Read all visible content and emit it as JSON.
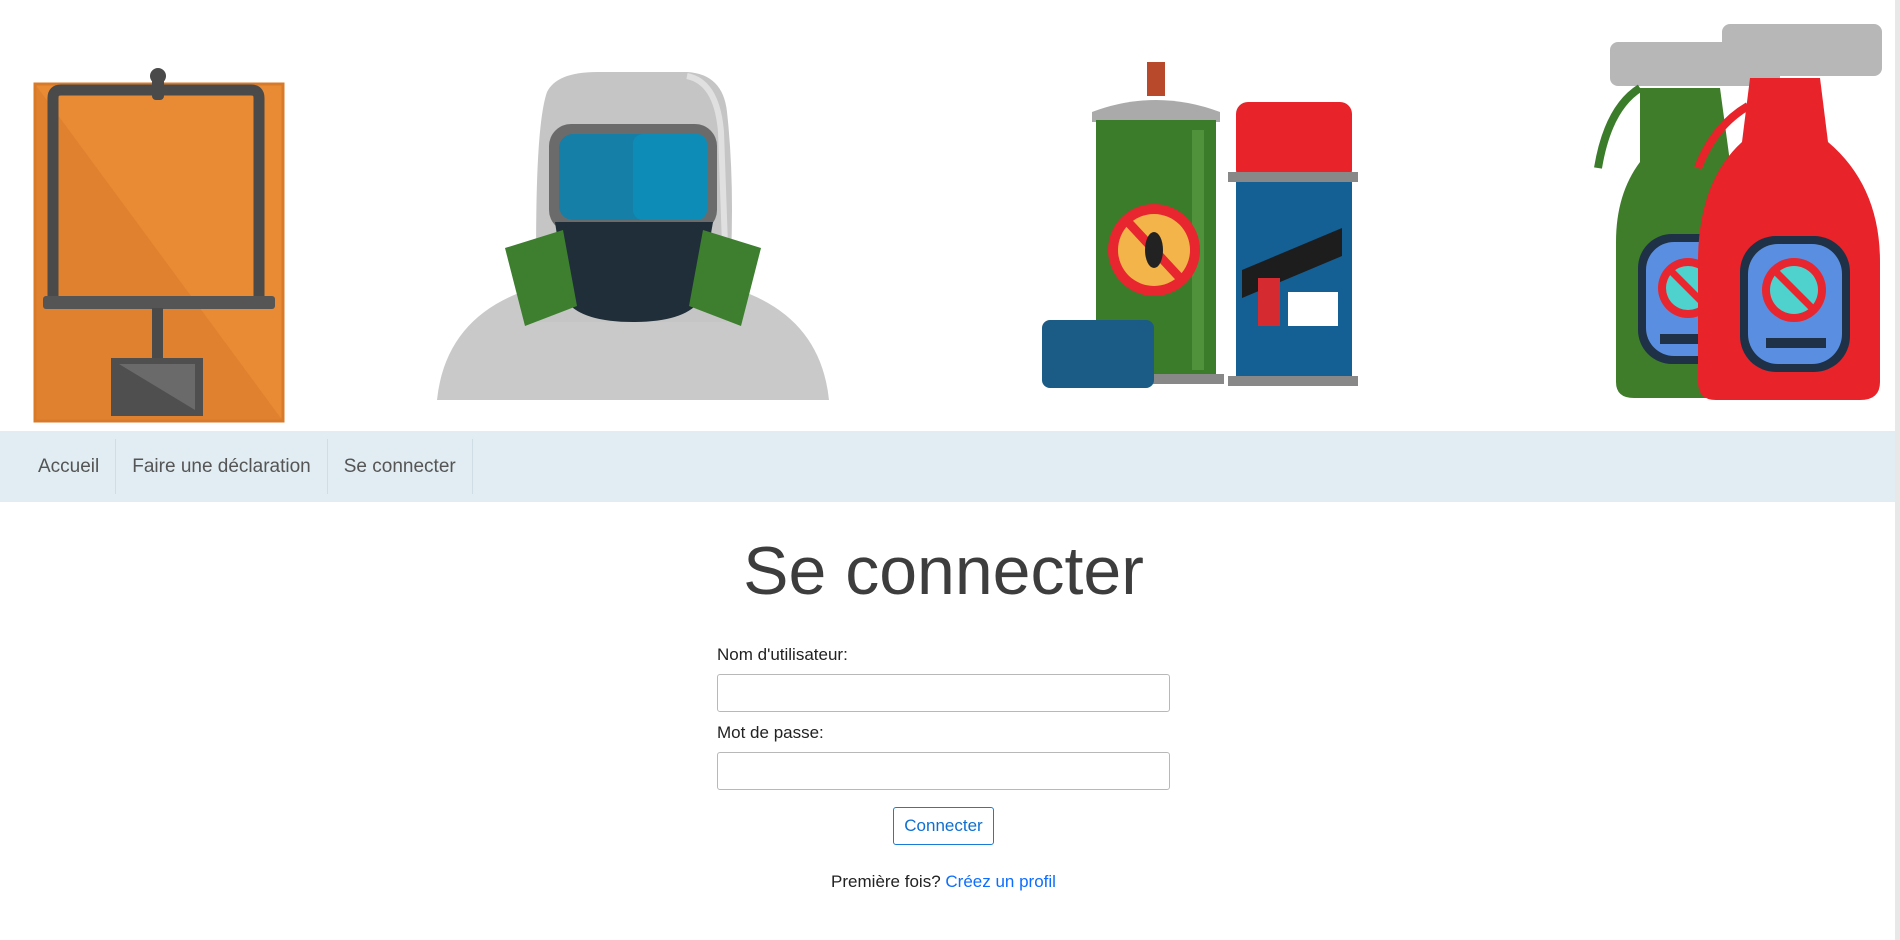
{
  "banner": {
    "images": [
      {
        "name": "mouse-trap-icon"
      },
      {
        "name": "hazmat-suit-icon"
      },
      {
        "name": "spray-cans-icon"
      },
      {
        "name": "spray-bottles-icon"
      }
    ]
  },
  "nav": {
    "items": [
      {
        "label": "Accueil"
      },
      {
        "label": "Faire une déclaration"
      },
      {
        "label": "Se connecter"
      }
    ]
  },
  "main": {
    "title": "Se connecter",
    "username_label": "Nom d'utilisateur:",
    "username_value": "",
    "password_label": "Mot de passe:",
    "password_value": "",
    "submit_label": "Connecter",
    "footer_text": "Première fois?",
    "footer_link": "Créez un profil"
  },
  "colors": {
    "nav_background": "#e1edf2",
    "link": "#0d6efd",
    "button_border": "#1a7bd6"
  }
}
